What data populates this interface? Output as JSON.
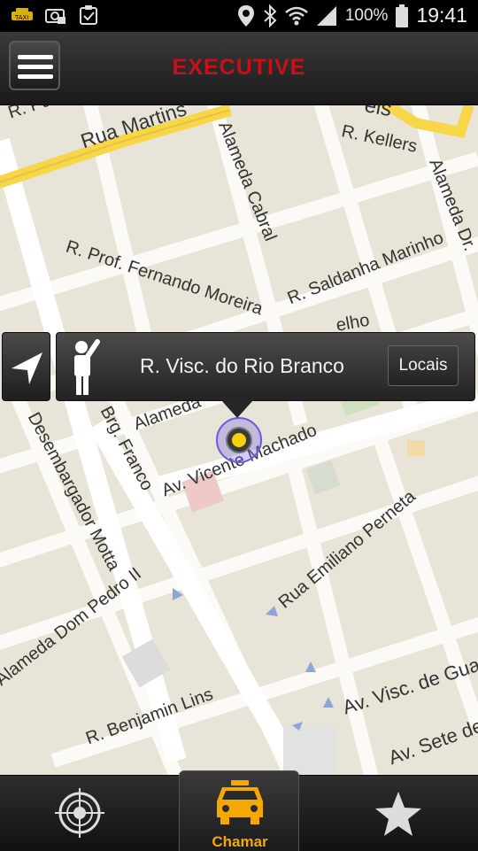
{
  "status_bar": {
    "notification_icons": [
      "taxi-app-icon",
      "camera-lock-icon",
      "clipboard-icon"
    ],
    "system_icons": [
      "location-icon",
      "bluetooth-icon",
      "wifi-icon",
      "signal-icon"
    ],
    "battery_percent": "100%",
    "time": "19:41"
  },
  "app_bar": {
    "title": "EXECUTIVE",
    "title_color": "#c8101a",
    "menu_icon": "hamburger-icon"
  },
  "map": {
    "streets": [
      "R. Padre",
      "Rua Martins",
      "Alameda Cabral",
      "R. Kellers",
      "Alameda Dr.",
      "R. Prof. Fernando Moreira",
      "R. Saldanha Marinho",
      "Alameda",
      "Av. Vicente Machado",
      "Desembargador Motta",
      "Brg. Franco",
      "Rua Emiliano Perneta",
      "Alameda Dom Pedro II",
      "R. Benjamin Lins",
      "Av. Visc. de Gua",
      "Av. Sete de",
      "elho",
      "els"
    ]
  },
  "address_popup": {
    "navigate_icon": "navigation-arrow-icon",
    "person_icon": "hailing-person-icon",
    "address": "R. Visc. do Rio Branco",
    "locais_button": "Locais"
  },
  "tabs": {
    "target_icon": "crosshair-target-icon",
    "chamar_icon": "taxi-icon",
    "chamar_label": "Chamar",
    "chamar_color": "#f5a800",
    "favorites_icon": "star-icon"
  }
}
